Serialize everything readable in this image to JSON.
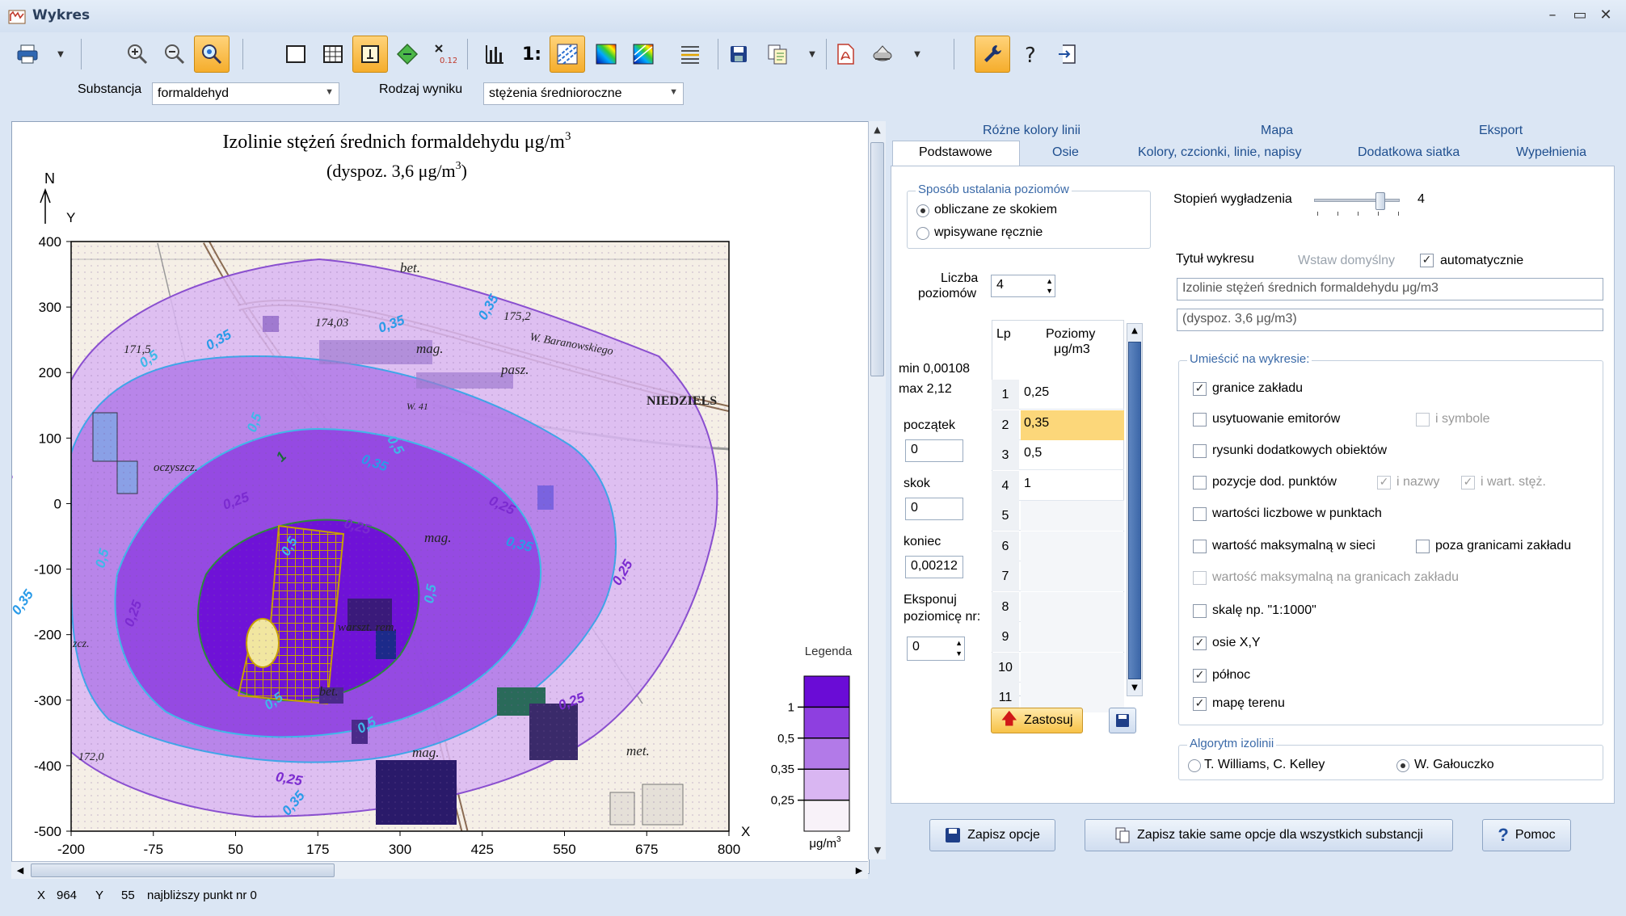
{
  "window": {
    "title": "Wykres"
  },
  "toolbar": {
    "buttons": [
      {
        "name": "print",
        "icon": "printer-icon"
      },
      {
        "name": "zoom-in",
        "icon": "zoom-in-icon"
      },
      {
        "name": "zoom-out",
        "icon": "zoom-out-icon"
      },
      {
        "name": "zoom-area",
        "icon": "zoom-area-icon",
        "active": true
      },
      {
        "name": "frame",
        "icon": "frame-icon"
      },
      {
        "name": "grid",
        "icon": "grid-icon"
      },
      {
        "name": "info",
        "icon": "info-icon",
        "active": true
      },
      {
        "name": "diamond",
        "icon": "emitter-icon"
      },
      {
        "name": "value-marker",
        "icon": "value-marker-icon"
      },
      {
        "name": "chart-type",
        "icon": "bar-chart-icon"
      },
      {
        "name": "scale",
        "icon": "scale-icon"
      },
      {
        "name": "lines",
        "icon": "isolines-icon",
        "active": true
      },
      {
        "name": "gradient-fill",
        "icon": "gradient-fill-icon"
      },
      {
        "name": "gradient-lines",
        "icon": "gradient-lines-icon"
      },
      {
        "name": "legend-lines",
        "icon": "legend-lines-icon"
      },
      {
        "name": "save",
        "icon": "save-icon"
      },
      {
        "name": "copy",
        "icon": "copy-icon"
      },
      {
        "name": "pdf",
        "icon": "pdf-icon"
      },
      {
        "name": "export-map",
        "icon": "export-map-icon"
      },
      {
        "name": "settings",
        "icon": "wrench-icon",
        "active": true
      },
      {
        "name": "help",
        "icon": "help-icon"
      },
      {
        "name": "exit",
        "icon": "exit-icon"
      }
    ],
    "scale_label": "1:",
    "value_label": "0,12"
  },
  "filters": {
    "substance_label": "Substancja",
    "substance_value": "formaldehyd",
    "result_label": "Rodzaj wyniku",
    "result_value": "stężenia średnioroczne"
  },
  "chart": {
    "title": "Izolinie stężeń średnich formaldehydu μg/m",
    "title_sup": "3",
    "subtitle": "(dyspoz. 3,6 μg/m",
    "subtitle_sup": "3",
    "subtitle_end": ")",
    "north_label": "N",
    "ylabel": "Y",
    "xlabel": "X",
    "legend_title": "Legenda",
    "legend_unit": "μg/m",
    "legend_unit_sup": "3",
    "map_labels": [
      "bet.",
      "174,03",
      "175,2",
      "W. Baranowskiego",
      "mag.",
      "pasz.",
      "NIEDZIELS",
      "171,5",
      "W. 41",
      "oczyszcz.",
      "mag.",
      "warszt. rem.",
      "bet.",
      "mag.",
      "met.",
      "172,0",
      "zcz."
    ]
  },
  "chart_data": {
    "type": "heatmap",
    "title": "Izolinie stężeń średnich formaldehydu μg/m3",
    "subtitle": "(dyspoz. 3,6 μg/m3)",
    "xlabel": "X",
    "ylabel": "Y",
    "xlim": [
      -200,
      800
    ],
    "ylim": [
      -500,
      400
    ],
    "x_ticks": [
      -200,
      -75,
      50,
      175,
      300,
      425,
      550,
      675,
      800
    ],
    "y_ticks": [
      400,
      300,
      200,
      100,
      0,
      -100,
      -200,
      -300,
      -400,
      -500
    ],
    "isoline_levels": [
      0.25,
      0.35,
      0.5,
      1
    ],
    "isoline_labels": [
      "0,25",
      "0,25",
      "0,25",
      "0,25",
      "0,25",
      "0,25",
      "0,25",
      "0,35",
      "0,35",
      "0,35",
      "0,35",
      "0,35",
      "0,35",
      "0,35",
      "0,5",
      "0,5",
      "0,5",
      "0,5",
      "0,5",
      "0,5",
      "0,5",
      "0,5",
      "1",
      "0,25"
    ],
    "legend": [
      "1",
      "0,5",
      "0,35",
      "0,25"
    ],
    "colors": [
      "#6a0cd6",
      "#8e3fe0",
      "#b27ae8",
      "#d9b6f2",
      "#f8f2f9"
    ]
  },
  "tabs": {
    "top": [
      "Różne kolory linii",
      "Mapa",
      "Eksport"
    ],
    "bottom": [
      "Podstawowe",
      "Osie",
      "Kolory, czcionki, linie, napisy",
      "Dodatkowa siatka",
      "Wypełnienia"
    ],
    "active": "Podstawowe"
  },
  "options": {
    "levels_group": "Sposób ustalania poziomów",
    "radio_calc": "obliczane ze skokiem",
    "radio_manual": "wpisywane ręcznie",
    "smoothing_label": "Stopień wygładzenia",
    "smoothing_value": "4",
    "smoothing_level": 4,
    "count_label_1": "Liczba",
    "count_label_2": "poziomów",
    "count_value": "4",
    "min_label": "min 0,00108",
    "max_label": "max 2,12",
    "start_label": "początek",
    "start_value": "0",
    "step_label": "skok",
    "step_value": "0",
    "end_label": "koniec",
    "end_value": "0,00212",
    "expose_label_1": "Eksponuj",
    "expose_label_2": "poziomicę nr:",
    "expose_value": "0",
    "grid_col_lp": "Lp",
    "grid_col_levels_1": "Poziomy",
    "grid_col_levels_2": "μg/m3",
    "grid_rows": [
      {
        "n": "1",
        "v": "0,25"
      },
      {
        "n": "2",
        "v": "0,35"
      },
      {
        "n": "3",
        "v": "0,5"
      },
      {
        "n": "4",
        "v": "1"
      },
      {
        "n": "5",
        "v": ""
      },
      {
        "n": "6",
        "v": ""
      },
      {
        "n": "7",
        "v": ""
      },
      {
        "n": "8",
        "v": ""
      },
      {
        "n": "9",
        "v": ""
      },
      {
        "n": "10",
        "v": ""
      },
      {
        "n": "11",
        "v": ""
      }
    ],
    "apply_button": "Zastosuj",
    "chart_title_label": "Tytuł wykresu",
    "default_insert": "Wstaw domyślny",
    "auto_label": "automatycznie",
    "title_value": "Izolinie stężeń średnich formaldehydu μg/m3",
    "subtitle_value": "(dyspoz. 3,6 μg/m3)",
    "place_group": "Umieścić na wykresie:",
    "chk_borders": "granice zakładu",
    "chk_emitters": "usytuowanie emitorów",
    "chk_symbols": "i symbole",
    "chk_drawings": "rysunki dodatkowych  obiektów",
    "chk_points": "pozycje dod. punktów",
    "chk_names": "i nazwy",
    "chk_values": "i wart. stęż.",
    "chk_numeric": "wartości liczbowe w punktach",
    "chk_max_grid": "wartość maksymalną w sieci",
    "chk_outside": "poza granicami zakładu",
    "chk_max_border": "wartość maksymalną na granicach zakładu",
    "chk_scale": "skalę  np. \"1:1000\"",
    "chk_axes": "osie X,Y",
    "chk_north": "północ",
    "chk_map": "mapę terenu",
    "algo_group": "Algorytm izolinii",
    "algo_1": "T. Williams, C. Kelley",
    "algo_2": "W. Gałouczko"
  },
  "bottom_buttons": {
    "save_options": "Zapisz opcje",
    "save_all": "Zapisz takie same opcje dla wszystkich substancji",
    "help": "Pomoc"
  },
  "status": {
    "x_label": "X",
    "x_value": "964",
    "y_label": "Y",
    "y_value": "55",
    "nearest": "najbliższy punkt nr 0"
  }
}
